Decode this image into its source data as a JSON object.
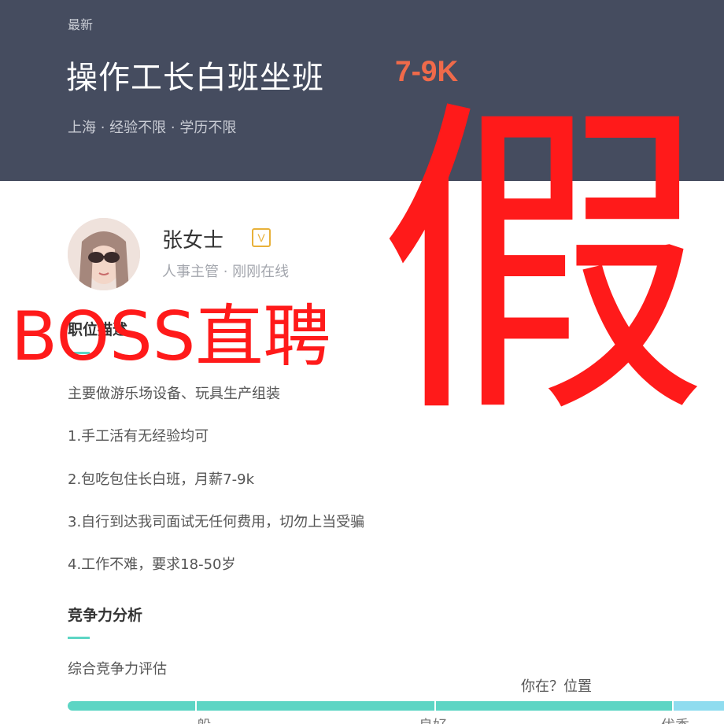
{
  "header": {
    "tag": "最新",
    "title": "操作工长白班坐班",
    "salary": "7-9K",
    "meta": "上海 · 经验不限 · 学历不限"
  },
  "recruiter": {
    "name": "张女士",
    "verified_badge": "V",
    "meta": "人事主管 · 刚刚在线"
  },
  "job_description": {
    "title": "职位描述",
    "lines": [
      "主要做游乐场设备、玩具生产组装",
      "1.手工活有无经验均可",
      "2.包吃包住长白班，月薪7-9k",
      "3.自行到达我司面试无任何费用，切勿上当受骗",
      "4.工作不难，要求18-50岁"
    ]
  },
  "competitiveness": {
    "title": "竞争力分析",
    "label": "综合竞争力评估",
    "position_label": "你在？位置",
    "scale": [
      "一般",
      "良好",
      "优秀"
    ]
  },
  "overlay": {
    "big_char": "假",
    "brand": "BOSS直聘"
  },
  "colors": {
    "header_bg": "#454c5f",
    "salary": "#f06a4a",
    "accent": "#5dd5c4",
    "overlay": "#ff1a1a"
  }
}
